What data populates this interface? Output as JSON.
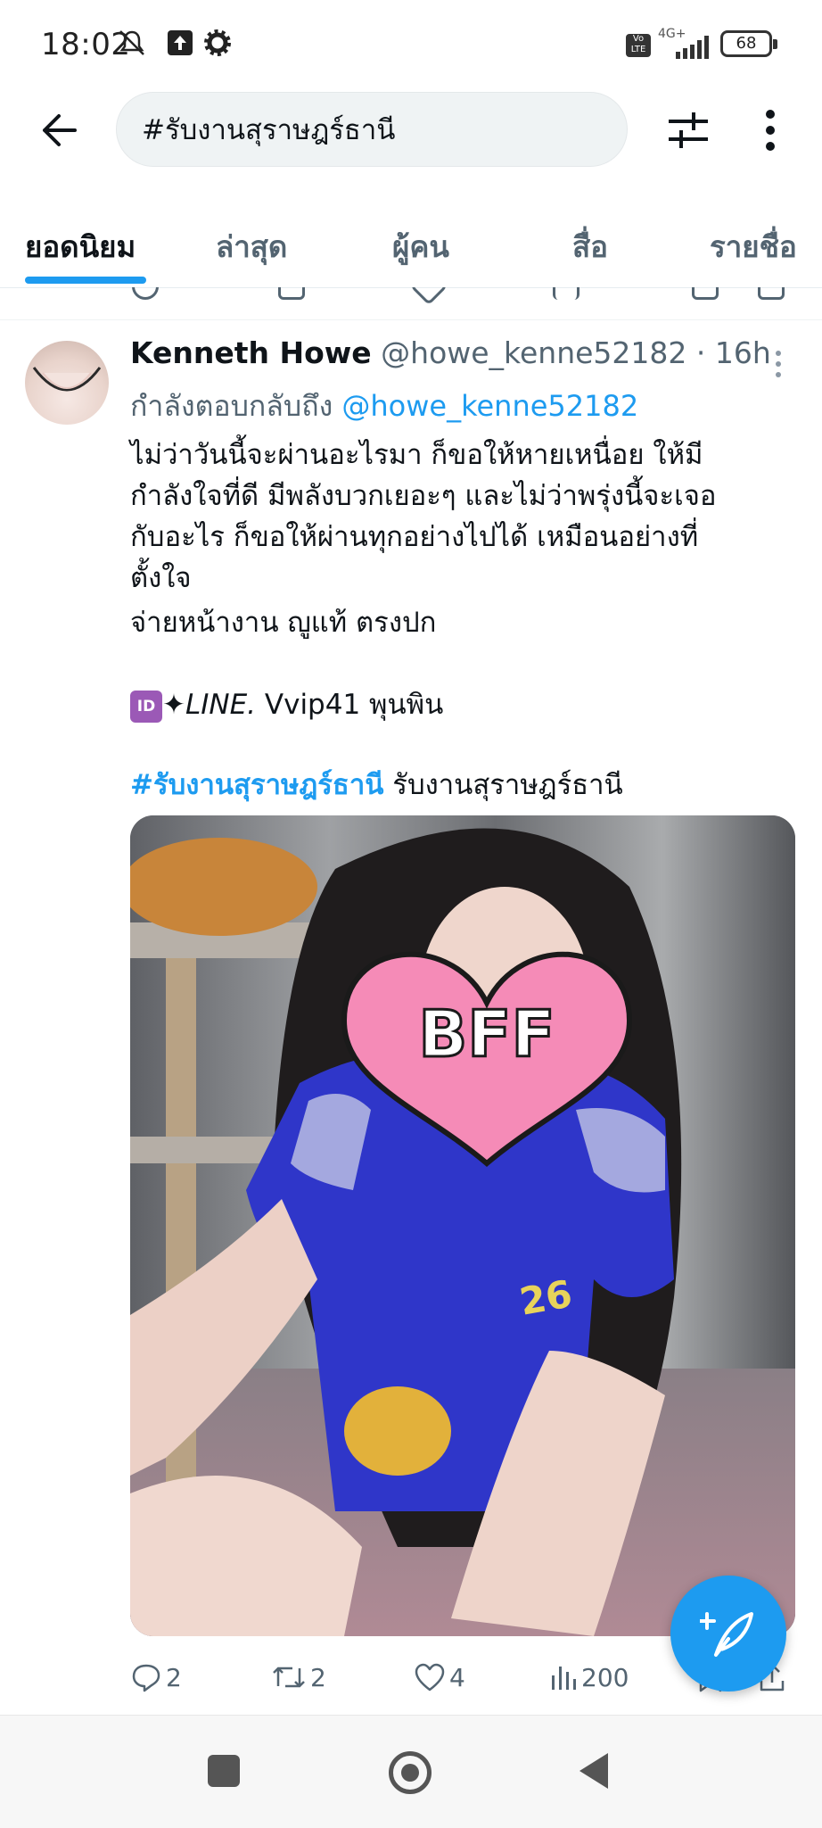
{
  "status_bar": {
    "time": "18:02",
    "network": "4G+",
    "volte": "Vo LTE",
    "battery": "68",
    "icons": [
      "mute-icon",
      "upload-icon",
      "settings-icon",
      "signal-icon",
      "battery-icon"
    ]
  },
  "header": {
    "back_icon": "arrow-left-icon",
    "search_value": "#รับงานสุราษฎร์ธานี",
    "filter_icon": "sliders-icon",
    "more_icon": "vertical-dots-icon"
  },
  "tabs": [
    {
      "label": "ยอดนิยม",
      "active": true
    },
    {
      "label": "ล่าสุด",
      "active": false
    },
    {
      "label": "ผู้คน",
      "active": false
    },
    {
      "label": "สื่อ",
      "active": false
    },
    {
      "label": "รายชื่อ",
      "active": false
    }
  ],
  "tweet": {
    "author_name": "Kenneth Howe",
    "handle": "@howe_kenne52182",
    "separator": " · ",
    "time": "16h",
    "reply_prefix": "กำลังตอบกลับถึง",
    "reply_mention": "@howe_kenne52182",
    "text_lines": [
      "ไม่ว่าวันนี้จะผ่านอะไรมา ก็ขอให้หายเหนื่อย  ให้มี",
      "กำลังใจที่ดี มีพลังบวกเยอะๆ และไม่ว่าพรุ่งนี้จะเจอ",
      "กับอะไร ก็ขอให้ผ่านทุกอย่างไปได้ เหมือนอย่างที่",
      "ตั้งใจ",
      "   จ่ายหน้างาน ญูแท้ ตรงปก"
    ],
    "id_badge": "ID",
    "sparkle": "✦",
    "line_label": "LINE.",
    "line_id": " Vvip41  พุนพิน",
    "hashtag": "#รับงานสุราษฎร์ธานี",
    "hashtag_suffix": " รับงานสุราษฎร์ธานี",
    "media_sticker": "BFF",
    "media_jersey_text": "26",
    "actions": {
      "replies": "2",
      "retweets": "2",
      "likes": "4",
      "views": "200"
    }
  },
  "fab_icon": "compose-tweet-icon",
  "nav": [
    "recent-apps-button",
    "home-button",
    "back-button"
  ],
  "colors": {
    "accent": "#1d9bf0",
    "text": "#0f1419",
    "muted": "#536471",
    "search_bg": "#eff3f4"
  }
}
